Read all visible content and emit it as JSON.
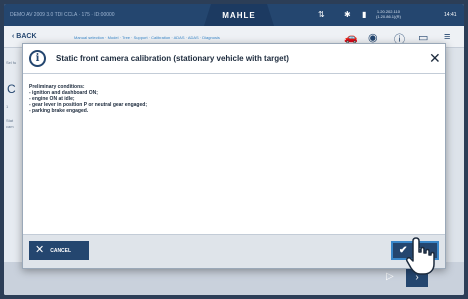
{
  "statusbar": {
    "vehicle": "DEMO AV 2009 3.0 TDI CCLA · 175 · ID:00000",
    "brand": "MAHLE",
    "ip_line1": "1.20.202.110",
    "ip_line2": "(1.20.86.1)(R)",
    "time": "14:41",
    "icons": [
      "network-icon",
      "bluetooth-icon",
      "battery-icon"
    ]
  },
  "navbar": {
    "back_label": "BACK",
    "crumbs": "Manual selection · Model · Tree · Support · Calibration · ADAS · ADAS · Diagnosis",
    "icons": [
      "car-icon",
      "wifi-icon",
      "help-icon",
      "cart-icon",
      "menu-icon"
    ]
  },
  "sidepanel": {
    "text1": "Sel fu",
    "text2": "1 ",
    "text3": "Stat",
    "text4": "cam",
    "letter": "C"
  },
  "dialog": {
    "title": "Static front camera calibration (stationary vehicle with target)",
    "conditions_heading": "Preliminary conditions:",
    "conditions": [
      "- ignition and dashboard ON;",
      "- engine ON at idle;",
      "- gear lever in position P or neutral gear engaged;",
      "- parking brake engaged."
    ],
    "cancel_label": "CANCEL",
    "ok_label": "OK"
  },
  "colors": {
    "primary": "#24466f",
    "accent": "#3a87c9",
    "footer": "#dfe4ea"
  }
}
